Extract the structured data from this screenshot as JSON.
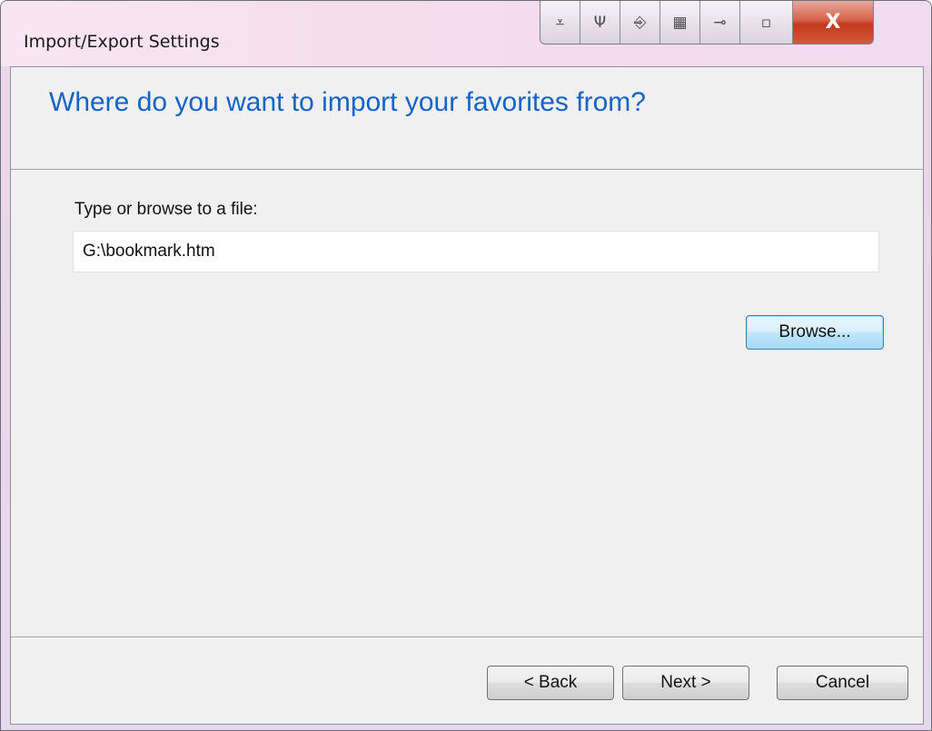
{
  "window": {
    "title": "Import/Export Settings",
    "caption_icons": [
      "down-arrow-icon",
      "plug-icon",
      "enter-icon",
      "keyboard-icon",
      "pin-icon"
    ],
    "caption_glyphs": {
      "down_arrow": "⩡",
      "plug": "Ψ",
      "enter": "⎆",
      "keyboard": "▦",
      "pin": "⊸",
      "minimize": "▫",
      "close": "X"
    }
  },
  "page": {
    "heading": "Where do you want to import your favorites from?",
    "prompt_label": "Type or browse to a file:",
    "file_path": "G:\\bookmark.htm"
  },
  "buttons": {
    "browse": "Browse...",
    "back": "< Back",
    "next": "Next >",
    "cancel": "Cancel"
  },
  "colors": {
    "heading": "#1464c8",
    "client_bg": "#f0f0f0",
    "close_button": "#c2381e"
  }
}
